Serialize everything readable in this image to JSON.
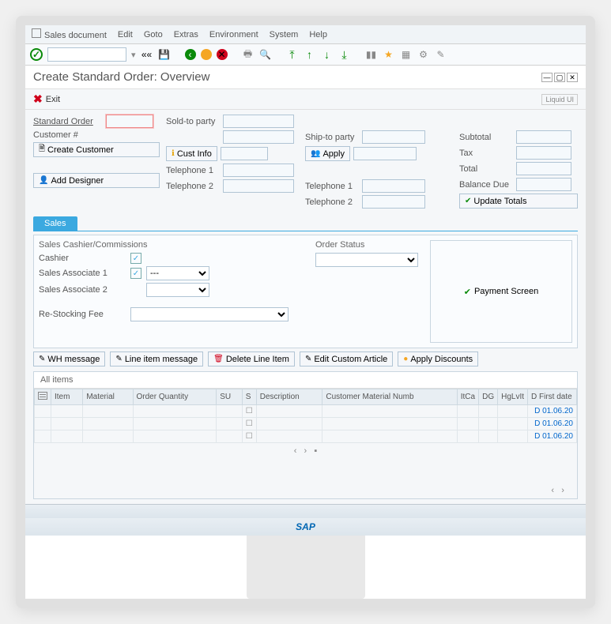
{
  "menu": {
    "doc": "Sales document",
    "edit": "Edit",
    "goto": "Goto",
    "extras": "Extras",
    "env": "Environment",
    "system": "System",
    "help": "Help"
  },
  "page": {
    "title": "Create Standard Order: Overview",
    "exit": "Exit",
    "liquid": "Liquid UI"
  },
  "left": {
    "standard_order": "Standard Order",
    "customer_num": "Customer #",
    "create_customer": "Create Customer",
    "add_designer": "Add Designer"
  },
  "soldto": {
    "label": "Sold-to party",
    "cust_info": "Cust Info",
    "tel1": "Telephone 1",
    "tel2": "Telephone 2"
  },
  "shipto": {
    "label": "Ship-to party",
    "apply": "Apply",
    "tel1": "Telephone 1",
    "tel2": "Telephone 2"
  },
  "summary": {
    "subtotal": "Subtotal",
    "tax": "Tax",
    "total": "Total",
    "balance": "Balance Due",
    "update": "Update Totals"
  },
  "tabs": {
    "sales": "Sales"
  },
  "commissions": {
    "title": "Sales Cashier/Commissions",
    "cashier": "Cashier",
    "assoc1": "Sales Associate 1",
    "assoc2": "Sales Associate 2",
    "sel_default": "---"
  },
  "restock": "Re-Stocking Fee",
  "order_status": {
    "label": "Order Status",
    "payment": "Payment Screen"
  },
  "actions": {
    "wh": "WH message",
    "line": "Line item message",
    "delete": "Delete Line Item",
    "edit": "Edit Custom Article",
    "discount": "Apply Discounts"
  },
  "items": {
    "title": "All items",
    "cols": {
      "item": "Item",
      "material": "Material",
      "qty": "Order Quantity",
      "su": "SU",
      "s": "S",
      "desc": "Description",
      "cust_mat": "Customer Material Numb",
      "itca": "ItCa",
      "dg": "DG",
      "hg": "HgLvIt",
      "date": "D First date"
    },
    "date_val": "D 01.06.20"
  },
  "brand": "SAP"
}
